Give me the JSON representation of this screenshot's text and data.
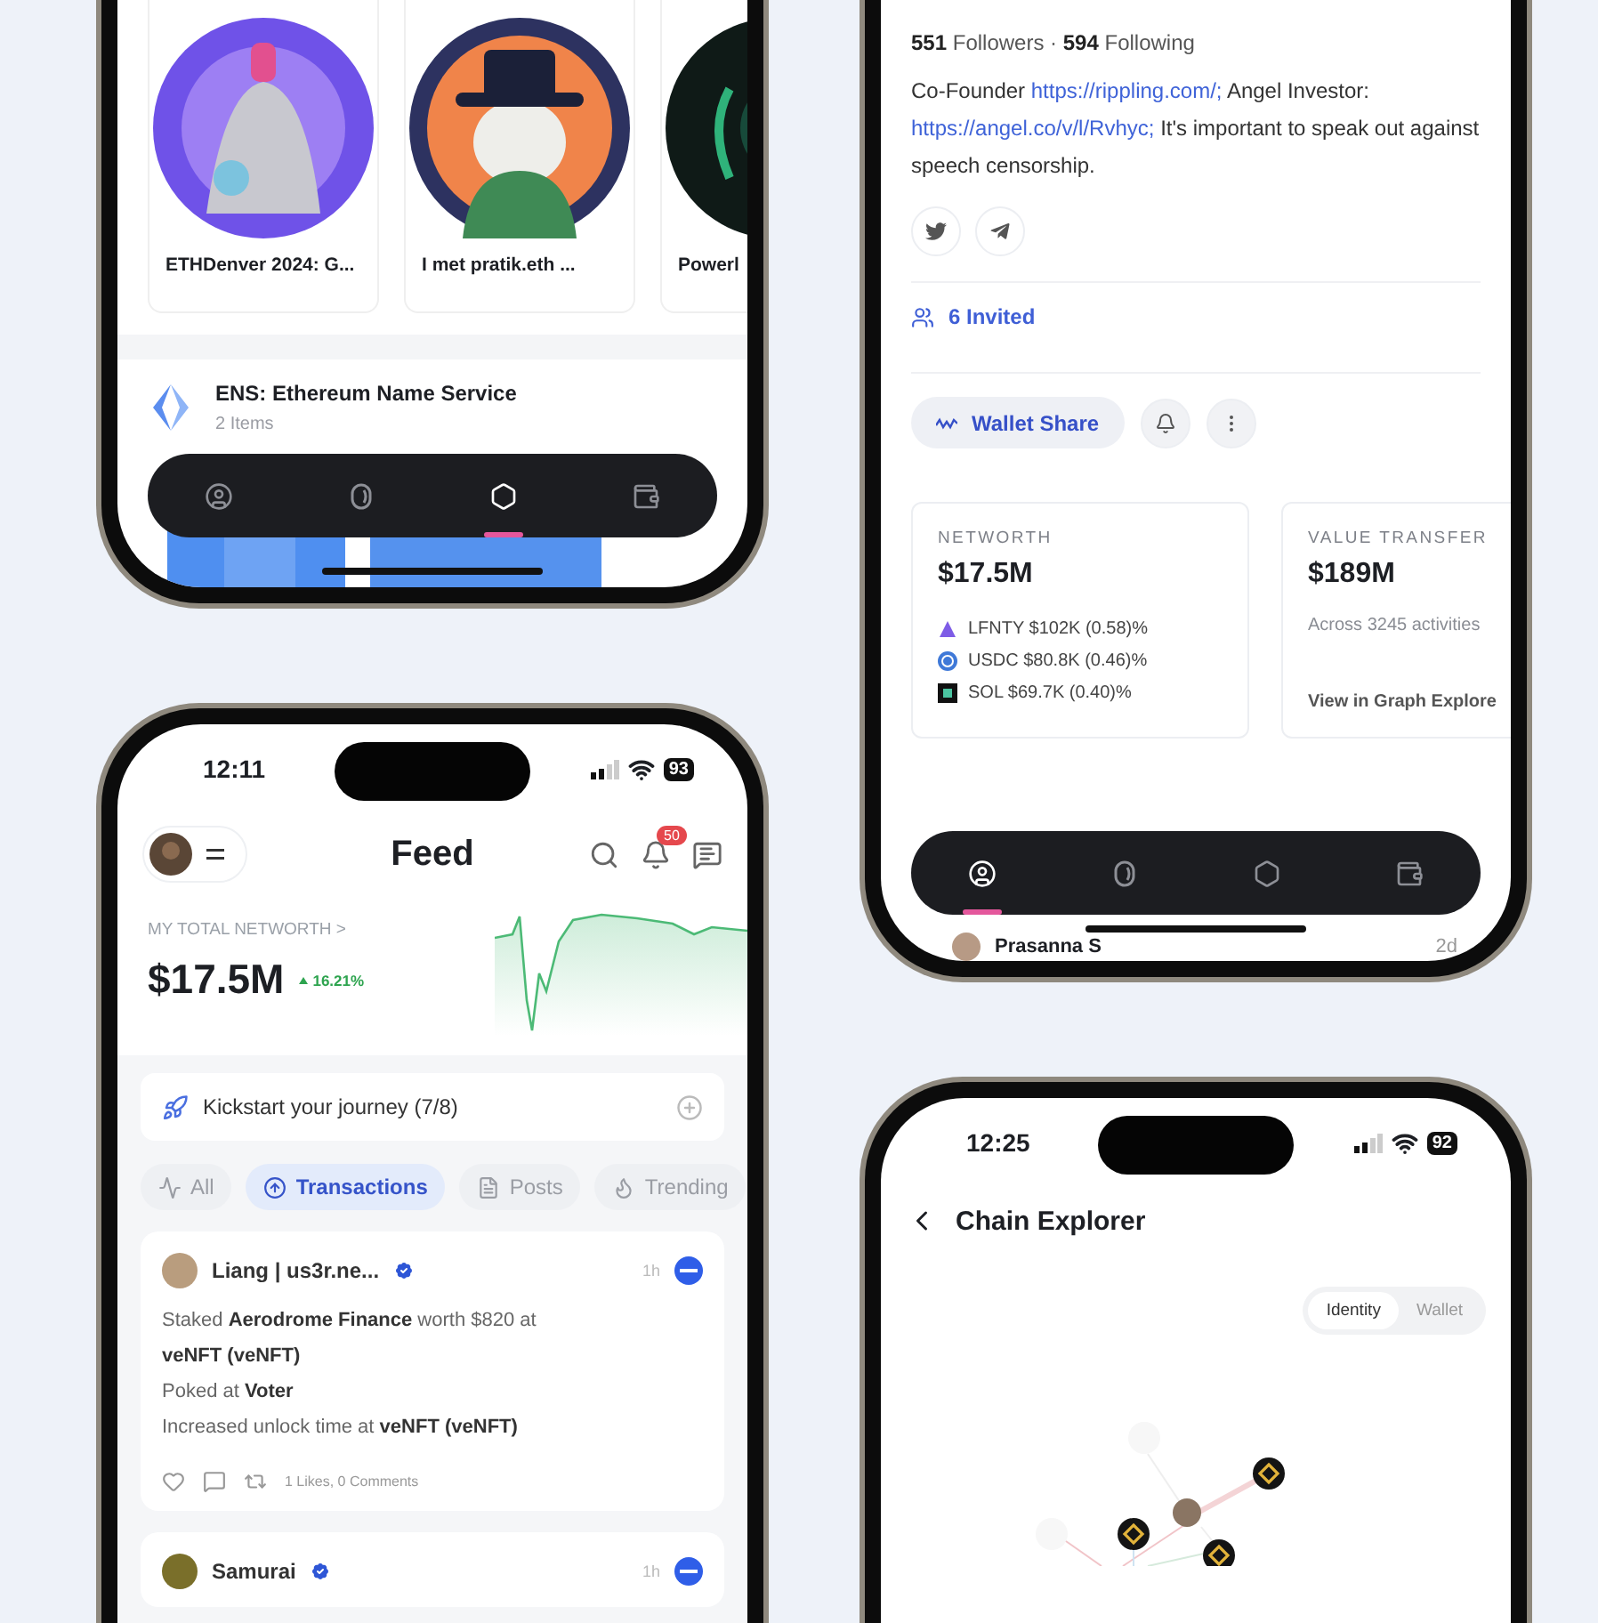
{
  "collections_screen": {
    "nft_cards": [
      {
        "title": "ETHDenver 2024: G...",
        "kind": "ethdenver"
      },
      {
        "title": "I met pratik.eth ...",
        "kind": "penguin"
      },
      {
        "title": "Powerl",
        "kind": "dark"
      }
    ],
    "collection": {
      "name": "ENS: Ethereum Name Service",
      "count": "2 Items"
    },
    "nav": [
      {
        "kind": "profile",
        "selected": false
      },
      {
        "kind": "token",
        "selected": false
      },
      {
        "kind": "explore",
        "selected": true
      },
      {
        "kind": "wallet",
        "selected": false
      }
    ]
  },
  "profile_screen": {
    "stats": "**551** Followers · **594** Following",
    "bio": [
      {
        "text": "Co-Founder ",
        "link": false
      },
      {
        "text": "https://rippling.com/;",
        "link": true
      },
      {
        "text": " Angel Investor: ",
        "link": false
      },
      {
        "text": "https://angel.co/v/l/Rvhyc;",
        "link": true
      },
      {
        "text": " It's important to speak out against speech censorship.",
        "link": false
      }
    ],
    "socials": [
      {
        "kind": "twitter"
      },
      {
        "kind": "telegram"
      }
    ],
    "invited": "6 Invited",
    "wallet_share": "Wallet Share",
    "networth": {
      "label": "NETWORTH",
      "value": "$17.5M",
      "holdings": [
        {
          "kind": "lfnty",
          "text": "LFNTY $102K (0.58)%"
        },
        {
          "kind": "usdc",
          "text": "USDC $80.8K (0.46)%"
        },
        {
          "kind": "sol",
          "text": "SOL $69.7K (0.40)%"
        }
      ]
    },
    "value_transfer": {
      "label": "VALUE TRANSFER",
      "value": "$189M",
      "note": "Across 3245 activities",
      "link": "View in Graph Explore"
    },
    "nav": [
      {
        "kind": "profile",
        "selected": true
      },
      {
        "kind": "token",
        "selected": false
      },
      {
        "kind": "explore",
        "selected": false
      },
      {
        "kind": "wallet",
        "selected": false
      }
    ],
    "next_post": {
      "author": "Prasanna S",
      "time": "2d"
    }
  },
  "feed_screen": {
    "status": {
      "time": "12:11",
      "battery": "93"
    },
    "title": "Feed",
    "notifications": "50",
    "networth": {
      "label": "MY TOTAL NETWORTH >",
      "value": "$17.5M",
      "change": "16.21%"
    },
    "kickstart": "Kickstart your journey (7/8)",
    "filters": [
      {
        "kind": "all",
        "label": "All",
        "selected": false
      },
      {
        "kind": "transactions",
        "label": "Transactions",
        "selected": true
      },
      {
        "kind": "posts",
        "label": "Posts",
        "selected": false
      },
      {
        "kind": "trending",
        "label": "Trending",
        "selected": false
      }
    ],
    "posts": [
      {
        "author": "Liang | us3r.ne...",
        "time": "1h",
        "lines": [
          "Staked **Aerodrome Finance** worth $820 at",
          "**veNFT (veNFT)**",
          "Poked at **Voter**",
          "Increased unlock time at **veNFT (veNFT)**"
        ],
        "engagement": "1 Likes, 0 Comments"
      },
      {
        "author": "Samurai",
        "time": "1h"
      }
    ]
  },
  "explorer_screen": {
    "status": {
      "time": "12:25",
      "battery": "92"
    },
    "title": "Chain Explorer",
    "modes": [
      {
        "label": "Identity",
        "selected": true
      },
      {
        "label": "Wallet",
        "selected": false
      }
    ]
  }
}
